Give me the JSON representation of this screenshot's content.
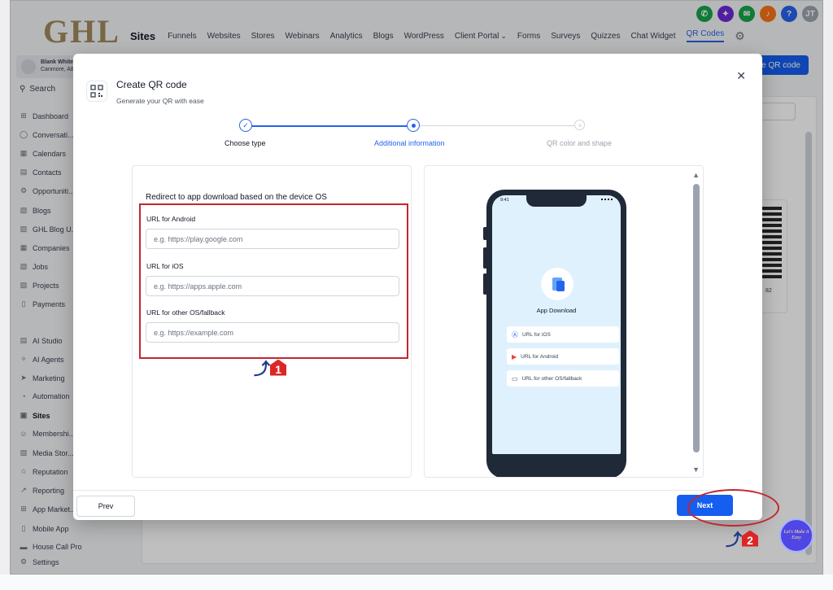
{
  "brand": {
    "logo_text": "GHL"
  },
  "topnav": {
    "section": "Sites",
    "items": [
      "Funnels",
      "Websites",
      "Stores",
      "Webinars",
      "Analytics",
      "Blogs",
      "WordPress",
      "Client Portal",
      "Forms",
      "Surveys",
      "Quizzes",
      "Chat Widget",
      "QR Codes"
    ],
    "active": "QR Codes"
  },
  "top_icons": [
    {
      "name": "phone-icon",
      "color": "#16a34a",
      "glyph": "✆"
    },
    {
      "name": "sparkle-icon",
      "color": "#6d28d9",
      "glyph": "✦"
    },
    {
      "name": "megaphone-icon",
      "color": "#16a34a",
      "glyph": "✉"
    },
    {
      "name": "bell-icon",
      "color": "#f97316",
      "glyph": "♪"
    },
    {
      "name": "help-icon",
      "color": "#2563eb",
      "glyph": "?"
    },
    {
      "name": "user-avatar",
      "color": "#9ca3af",
      "glyph": "JT"
    }
  ],
  "account": {
    "name": "Blank Whitel...",
    "location": "Canmore, AB"
  },
  "sidebar": {
    "search_label": "Search",
    "items": [
      {
        "label": "Dashboard",
        "icon": "⊞"
      },
      {
        "label": "Conversati...",
        "icon": "◯"
      },
      {
        "label": "Calendars",
        "icon": "▦"
      },
      {
        "label": "Contacts",
        "icon": "▤"
      },
      {
        "label": "Opportuniti...",
        "icon": "⚙"
      },
      {
        "label": "Blogs",
        "icon": "▧"
      },
      {
        "label": "GHL Blog U...",
        "icon": "▧"
      },
      {
        "label": "Companies",
        "icon": "▦"
      },
      {
        "label": "Jobs",
        "icon": "▧"
      },
      {
        "label": "Projects",
        "icon": "▧"
      },
      {
        "label": "Payments",
        "icon": "▯"
      },
      {
        "label": "AI Studio",
        "icon": "▤"
      },
      {
        "label": "AI Agents",
        "icon": "✧"
      },
      {
        "label": "Marketing",
        "icon": "➤"
      },
      {
        "label": "Automation",
        "icon": "◔"
      },
      {
        "label": "Sites",
        "icon": "▣"
      },
      {
        "label": "Membershi...",
        "icon": "☺"
      },
      {
        "label": "Media Stor...",
        "icon": "▨"
      },
      {
        "label": "Reputation",
        "icon": "☆"
      },
      {
        "label": "Reporting",
        "icon": "↗"
      },
      {
        "label": "App Market...",
        "icon": "⊞"
      },
      {
        "label": "Mobile App",
        "icon": "▯"
      },
      {
        "label": "House Call Pro",
        "icon": "▬"
      },
      {
        "label": "Settings",
        "icon": "⚙"
      }
    ],
    "active": "Sites"
  },
  "background": {
    "create_button": "ate QR code",
    "qr_caption": "82"
  },
  "modal": {
    "title": "Create QR code",
    "subtitle": "Generate your QR with ease",
    "steps": [
      {
        "label": "Choose type",
        "state": "done"
      },
      {
        "label": "Additional information",
        "state": "current"
      },
      {
        "label": "QR color and shape",
        "state": "todo"
      }
    ],
    "form": {
      "heading": "Redirect to app download based on the device OS",
      "fields": [
        {
          "label": "URL for Android",
          "placeholder": "e.g. https://play.google.com",
          "value": ""
        },
        {
          "label": "URL for iOS",
          "placeholder": "e.g. https://apps.apple.com",
          "value": ""
        },
        {
          "label": "URL for other OS/fallback",
          "placeholder": "e.g. https://example.com",
          "value": ""
        }
      ]
    },
    "preview": {
      "time": "9:41",
      "app_title": "App Download",
      "links": [
        {
          "label": "URL for iOS",
          "icon": "ios-store-icon",
          "glyph": "Ⓐ"
        },
        {
          "label": "URL for Android",
          "icon": "play-store-icon",
          "glyph": "▶"
        },
        {
          "label": "URL for other OS/fallback",
          "icon": "devices-icon",
          "glyph": "▭"
        }
      ]
    },
    "buttons": {
      "prev": "Prev",
      "next": "Next"
    }
  },
  "annotations": {
    "marker_1": "1",
    "marker_2": "2"
  },
  "fab": {
    "text": "Let's Make it Easy"
  },
  "colors": {
    "primary": "#155eef",
    "highlight": "#c2272d",
    "brand_gold": "#a08a5c"
  }
}
